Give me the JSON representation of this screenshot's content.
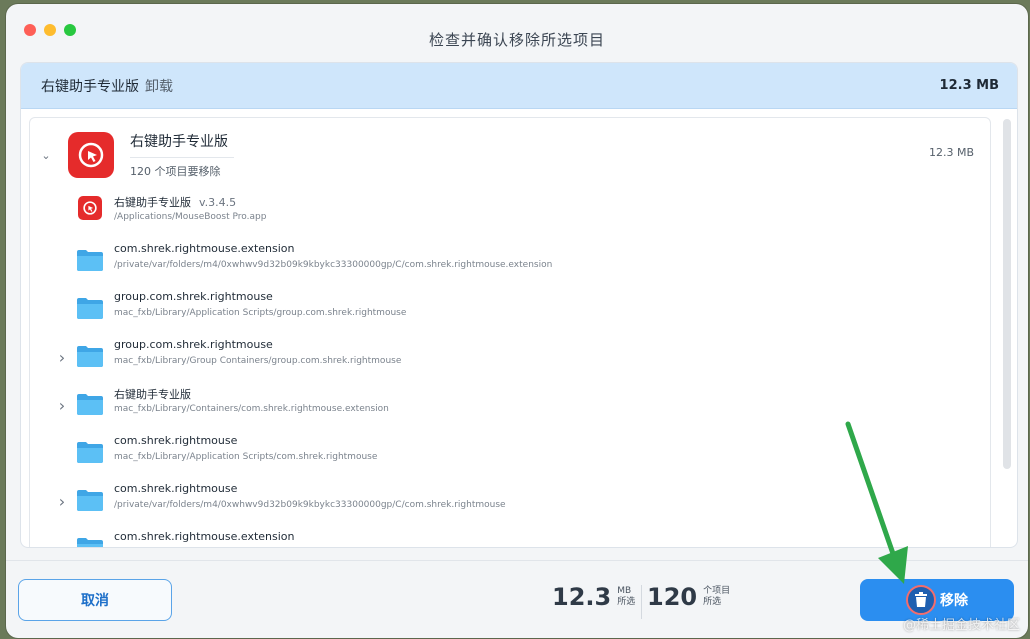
{
  "window": {
    "title": "检查并确认移除所选项目"
  },
  "header": {
    "app_name": "右键助手专业版",
    "action": "卸载",
    "size": "12.3 MB"
  },
  "app": {
    "name": "右键助手专业版",
    "count_text": "120 个项目要移除",
    "size": "12.3 MB"
  },
  "items": [
    {
      "name": "右键助手专业版",
      "version": "v.3.4.5",
      "path": "/Applications/MouseBoost Pro.app",
      "icon": "app-icon",
      "expandable": false
    },
    {
      "name": "com.shrek.rightmouse.extension",
      "version": "",
      "path": "/private/var/folders/m4/0xwhwv9d32b09k9kbykc33300000gp/C/com.shrek.rightmouse.extension",
      "icon": "folder-icon",
      "expandable": false
    },
    {
      "name": "group.com.shrek.rightmouse",
      "version": "",
      "path": "mac_fxb/Library/Application Scripts/group.com.shrek.rightmouse",
      "icon": "folder-icon",
      "expandable": false
    },
    {
      "name": "group.com.shrek.rightmouse",
      "version": "",
      "path": "mac_fxb/Library/Group Containers/group.com.shrek.rightmouse",
      "icon": "folder-icon",
      "expandable": true
    },
    {
      "name": "右键助手专业版",
      "version": "",
      "path": "mac_fxb/Library/Containers/com.shrek.rightmouse.extension",
      "icon": "folder-icon",
      "expandable": true
    },
    {
      "name": "com.shrek.rightmouse",
      "version": "",
      "path": "mac_fxb/Library/Application Scripts/com.shrek.rightmouse",
      "icon": "folder-icon",
      "expandable": false
    },
    {
      "name": "com.shrek.rightmouse",
      "version": "",
      "path": "/private/var/folders/m4/0xwhwv9d32b09k9kbykc33300000gp/C/com.shrek.rightmouse",
      "icon": "folder-icon",
      "expandable": true
    },
    {
      "name": "com.shrek.rightmouse.extension",
      "version": "",
      "path": "",
      "icon": "folder-icon",
      "expandable": false
    }
  ],
  "footer": {
    "cancel_label": "取消",
    "size_num": "12.3",
    "size_unit": "MB",
    "size_label": "所选",
    "count_num": "120",
    "count_unit": "个项目",
    "count_label": "所选",
    "remove_label": "移除"
  },
  "watermark": "@稀土掘金技术社区",
  "colors": {
    "accent": "#2b8ef0",
    "header_bg": "#cfe6fb",
    "app_red": "#e52b2b",
    "folder_blue": "#4fb3f0",
    "arrow_green": "#2fa84a"
  }
}
